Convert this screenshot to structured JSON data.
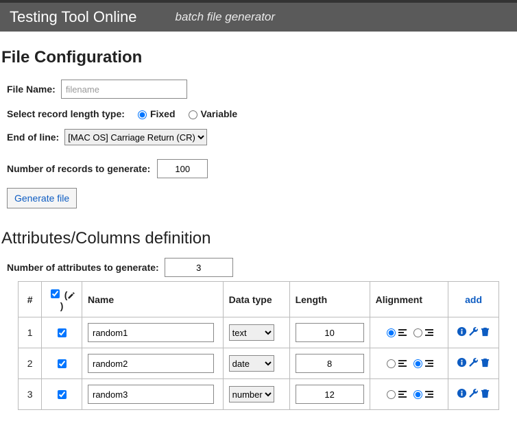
{
  "header": {
    "title": "Testing Tool Online",
    "subtitle": "batch file generator"
  },
  "fileConfig": {
    "sectionTitle": "File Configuration",
    "fileNameLabel": "File Name:",
    "fileNamePlaceholder": "filename",
    "fileNameValue": "",
    "recordTypeLabel": "Select record length type:",
    "recordTypeFixed": "Fixed",
    "recordTypeVariable": "Variable",
    "eolLabel": "End of line:",
    "eolSelected": "[MAC OS] Carriage Return (CR)",
    "numRecordsLabel": "Number of records to generate:",
    "numRecordsValue": "100",
    "generateBtn": "Generate file"
  },
  "attrs": {
    "sectionTitle": "Attributes/Columns definition",
    "numAttrsLabel": "Number of attributes to generate:",
    "numAttrsValue": "3",
    "headers": {
      "num": "#",
      "name": "Name",
      "type": "Data type",
      "length": "Length",
      "alignment": "Alignment",
      "add": "add"
    },
    "rows": [
      {
        "num": "1",
        "checked": true,
        "name": "random1",
        "type": "text",
        "length": "10",
        "align": "left"
      },
      {
        "num": "2",
        "checked": true,
        "name": "random2",
        "type": "date",
        "length": "8",
        "align": "right"
      },
      {
        "num": "3",
        "checked": true,
        "name": "random3",
        "type": "number",
        "length": "12",
        "align": "right"
      }
    ]
  },
  "colors": {
    "link": "#0d5cc2"
  }
}
